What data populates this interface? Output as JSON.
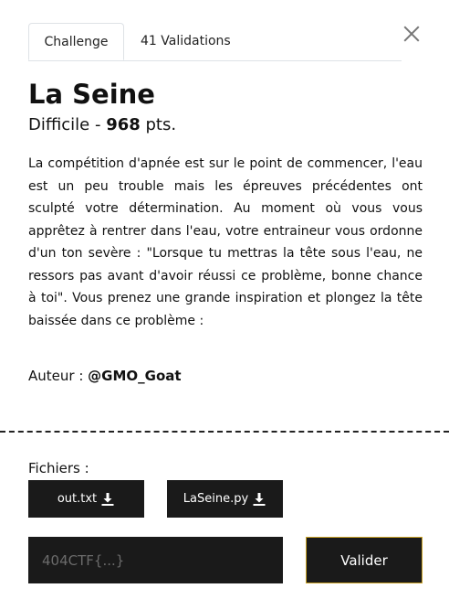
{
  "tabs": [
    {
      "label": "Challenge",
      "active": true
    },
    {
      "label": "41 Validations",
      "active": false
    }
  ],
  "challenge": {
    "title": "La Seine",
    "difficulty": "Difficile",
    "separator": " - ",
    "points": "968",
    "points_unit": " pts.",
    "description": "La compétition d'apnée est sur le point de commencer, l'eau est un peu trouble mais les épreuves précédentes ont sculpté votre détermination. Au moment où vous vous apprêtez à rentrer dans l'eau, votre entraineur vous ordonne d'un ton sevère : \"Lorsque tu mettras la tête sous l'eau, ne ressors pas avant d'avoir réussi ce problème, bonne chance à toi\". Vous prenez une grande inspiration et plongez la tête baissée dans ce problème :",
    "author_label": "Auteur : ",
    "author": "@GMO_Goat"
  },
  "files": {
    "label": "Fichiers :",
    "items": [
      {
        "name": "out.txt",
        "icon": "download-icon"
      },
      {
        "name": "LaSeine.py",
        "icon": "download-icon"
      }
    ]
  },
  "flag_input": {
    "placeholder": "404CTF{...}",
    "value": ""
  },
  "submit_label": "Valider",
  "colors": {
    "dark": "#1a1a1a",
    "accent": "#c9a227"
  }
}
